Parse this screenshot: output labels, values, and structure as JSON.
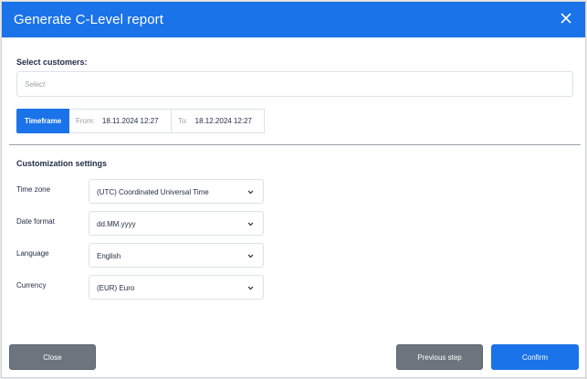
{
  "dialog": {
    "title": "Generate C-Level report",
    "close_icon": "close-icon"
  },
  "customers": {
    "label": "Select customers:",
    "placeholder": "Select"
  },
  "timeframe": {
    "button_label": "Timeframe",
    "from_label": "From:",
    "from_value": "18.11.2024 12:27",
    "to_label": "To:",
    "to_value": "18.12.2024 12:27"
  },
  "customization": {
    "title": "Customization settings",
    "timezone_label": "Time zone",
    "timezone_value": "(UTC) Coordinated Universal Time",
    "date_format_label": "Date format",
    "date_format_value": "dd.MM.yyyy",
    "language_label": "Language",
    "language_value": "English",
    "currency_label": "Currency",
    "currency_value": "(EUR) Euro"
  },
  "footer": {
    "close_label": "Close",
    "previous_label": "Previous step",
    "confirm_label": "Confirm"
  },
  "colors": {
    "accent": "#1a73e8",
    "secondary_button": "#6c757d"
  }
}
